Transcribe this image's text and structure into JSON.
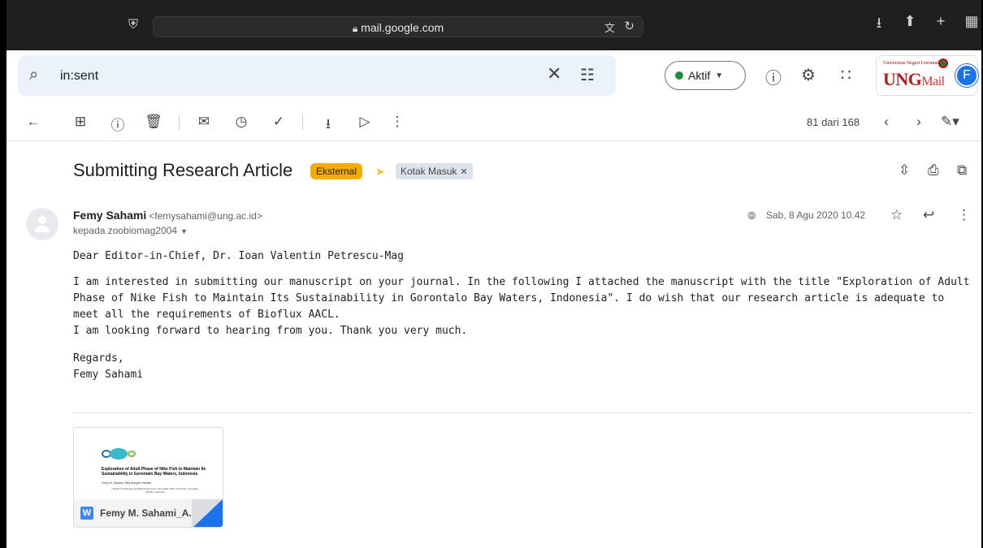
{
  "browser": {
    "url": "mail.google.com"
  },
  "search": {
    "query": "in:sent"
  },
  "header": {
    "status_label": "Aktif",
    "logo_text_main": "UNG",
    "logo_text_mail": "Mail",
    "logo_univ_text": "Universitas Negeri Gorontalo",
    "avatar_letter": "F"
  },
  "toolbar": {
    "page_count": "81 dari 168"
  },
  "email": {
    "subject": "Submitting Research Article",
    "labels": [
      "Eksternal",
      "Kotak Masuk"
    ],
    "sender_name": "Femy Sahami",
    "sender_email": "<femysahami@ung.ac.id>",
    "recipient": "kepada zoobiomag2004",
    "date": "Sab, 8 Agu 2020 10.42",
    "body": {
      "salutation": "Dear  Editor-in-Chief, Dr. Ioan Valentin Petrescu-Mag",
      "paragraph_1": "I am interested in submitting our manuscript on your journal. In the following I attached the manuscript with the title \"Exploration of Adult Phase of Nike Fish to Maintain Its Sustainability in Gorontalo Bay Waters, Indonesia\". I do wish that our research article is adequate to meet all the requirements of Bioflux AACL.",
      "paragraph_2": "I am looking forward to hearing from you. Thank you very much.",
      "closing": "Regards,",
      "signature": "Femy Sahami"
    }
  },
  "attachment": {
    "file_name": "Femy M. Sahami_A...",
    "file_type_icon": "W",
    "preview_title": "Exploration of Adult Phase of Nike Fish to Maintain Its Sustainability in Gorontalo Bay Waters, Indonesia",
    "preview_authors": "Femy M. Sahami, Sitty Ainsyah Habibie",
    "preview_affiliation": "Faculty of Fisheries and Marine Sciences, Gorontalo State University, Gorontalo, 96128, Indonesia"
  },
  "colors": {
    "search_bg": "#eaf1fb",
    "status_dot": "#1e8e3e",
    "label_eksternal": "#f6ab00",
    "avatar_bg": "#1a73e8"
  }
}
